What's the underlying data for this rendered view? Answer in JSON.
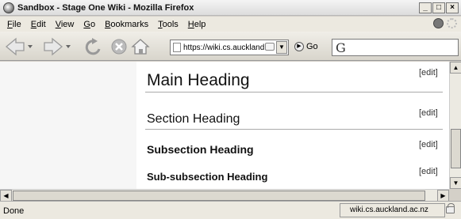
{
  "window": {
    "title": "Sandbox - Stage One Wiki - Mozilla Firefox",
    "minimize": "_",
    "maximize": "□",
    "close": "×"
  },
  "menu": {
    "items": [
      {
        "pre": "",
        "key": "F",
        "post": "ile"
      },
      {
        "pre": "",
        "key": "E",
        "post": "dit"
      },
      {
        "pre": "",
        "key": "V",
        "post": "iew"
      },
      {
        "pre": "",
        "key": "G",
        "post": "o"
      },
      {
        "pre": "",
        "key": "B",
        "post": "ookmarks"
      },
      {
        "pre": "",
        "key": "T",
        "post": "ools"
      },
      {
        "pre": "",
        "key": "H",
        "post": "elp"
      }
    ]
  },
  "toolbar": {
    "url": "https://wiki.cs.auckland.ac",
    "go_label": "Go",
    "search_engine": "G"
  },
  "page": {
    "headings": {
      "main": "Main Heading",
      "section": "Section Heading",
      "subsection": "Subsection Heading",
      "subsubsection": "Sub-subsection Heading"
    },
    "edit_label": "[edit]"
  },
  "statusbar": {
    "status": "Done",
    "host": "wiki.cs.auckland.ac.nz"
  },
  "icons": {
    "back": "back-arrow-icon",
    "forward": "forward-arrow-icon",
    "reload": "reload-icon",
    "stop": "stop-icon",
    "home": "home-icon",
    "security": "lock-icon"
  }
}
